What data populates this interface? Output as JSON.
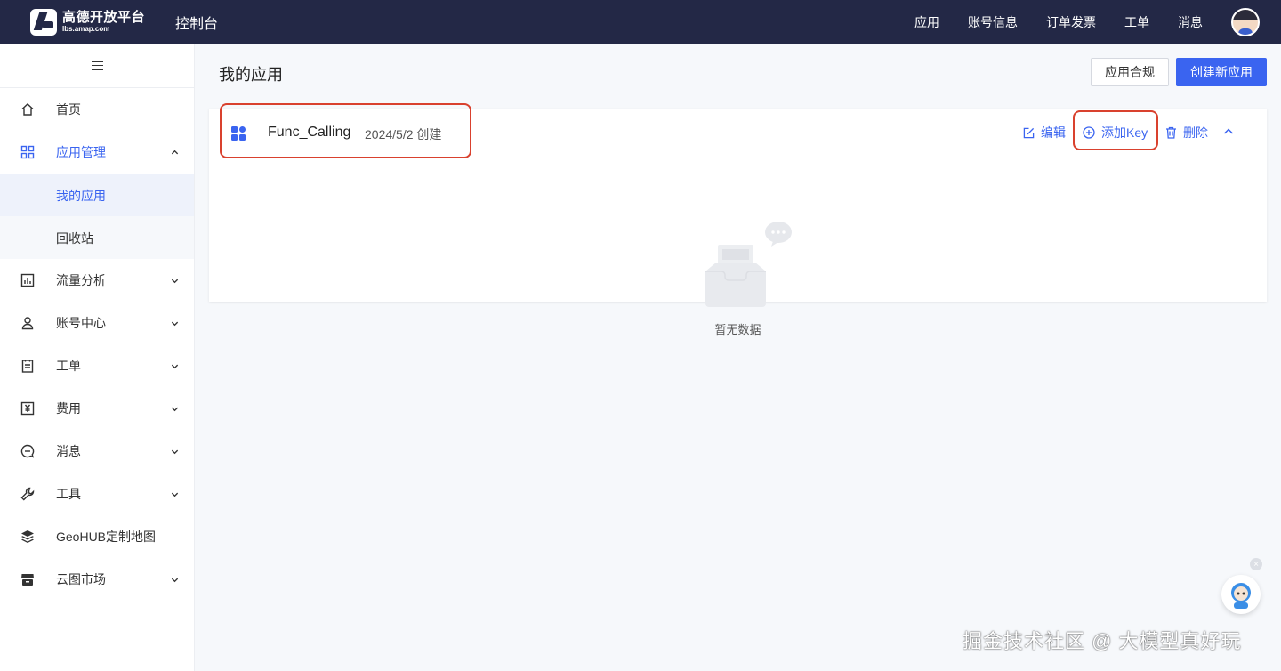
{
  "header": {
    "logo_title": "高德开放平台",
    "logo_sub": "lbs.amap.com",
    "console": "控制台",
    "nav": [
      "应用",
      "账号信息",
      "订单发票",
      "工单",
      "消息"
    ]
  },
  "sidebar": {
    "items": [
      {
        "label": "首页",
        "icon": "home-icon"
      },
      {
        "label": "应用管理",
        "icon": "grid-icon",
        "expanded": true
      },
      {
        "label": "我的应用",
        "sub": true,
        "selected": true
      },
      {
        "label": "回收站",
        "sub": true
      },
      {
        "label": "流量分析",
        "icon": "chart-icon"
      },
      {
        "label": "账号中心",
        "icon": "user-icon"
      },
      {
        "label": "工单",
        "icon": "clipboard-icon"
      },
      {
        "label": "费用",
        "icon": "yuan-icon"
      },
      {
        "label": "消息",
        "icon": "message-icon"
      },
      {
        "label": "工具",
        "icon": "wrench-icon"
      },
      {
        "label": "GeoHUB定制地图",
        "icon": "layers-icon"
      },
      {
        "label": "云图市场",
        "icon": "store-icon"
      }
    ]
  },
  "main": {
    "title": "我的应用",
    "compliance_btn": "应用合规",
    "create_btn": "创建新应用",
    "app": {
      "name": "Func_Calling",
      "created": "2024/5/2 创建",
      "actions": {
        "edit": "编辑",
        "add_key": "添加Key",
        "delete": "删除"
      }
    },
    "empty_text": "暂无数据"
  },
  "watermark": "掘金技术社区 @ 大模型真好玩",
  "colors": {
    "primary": "#3a64f0",
    "topbar": "#232846",
    "highlight": "#d9412e"
  }
}
